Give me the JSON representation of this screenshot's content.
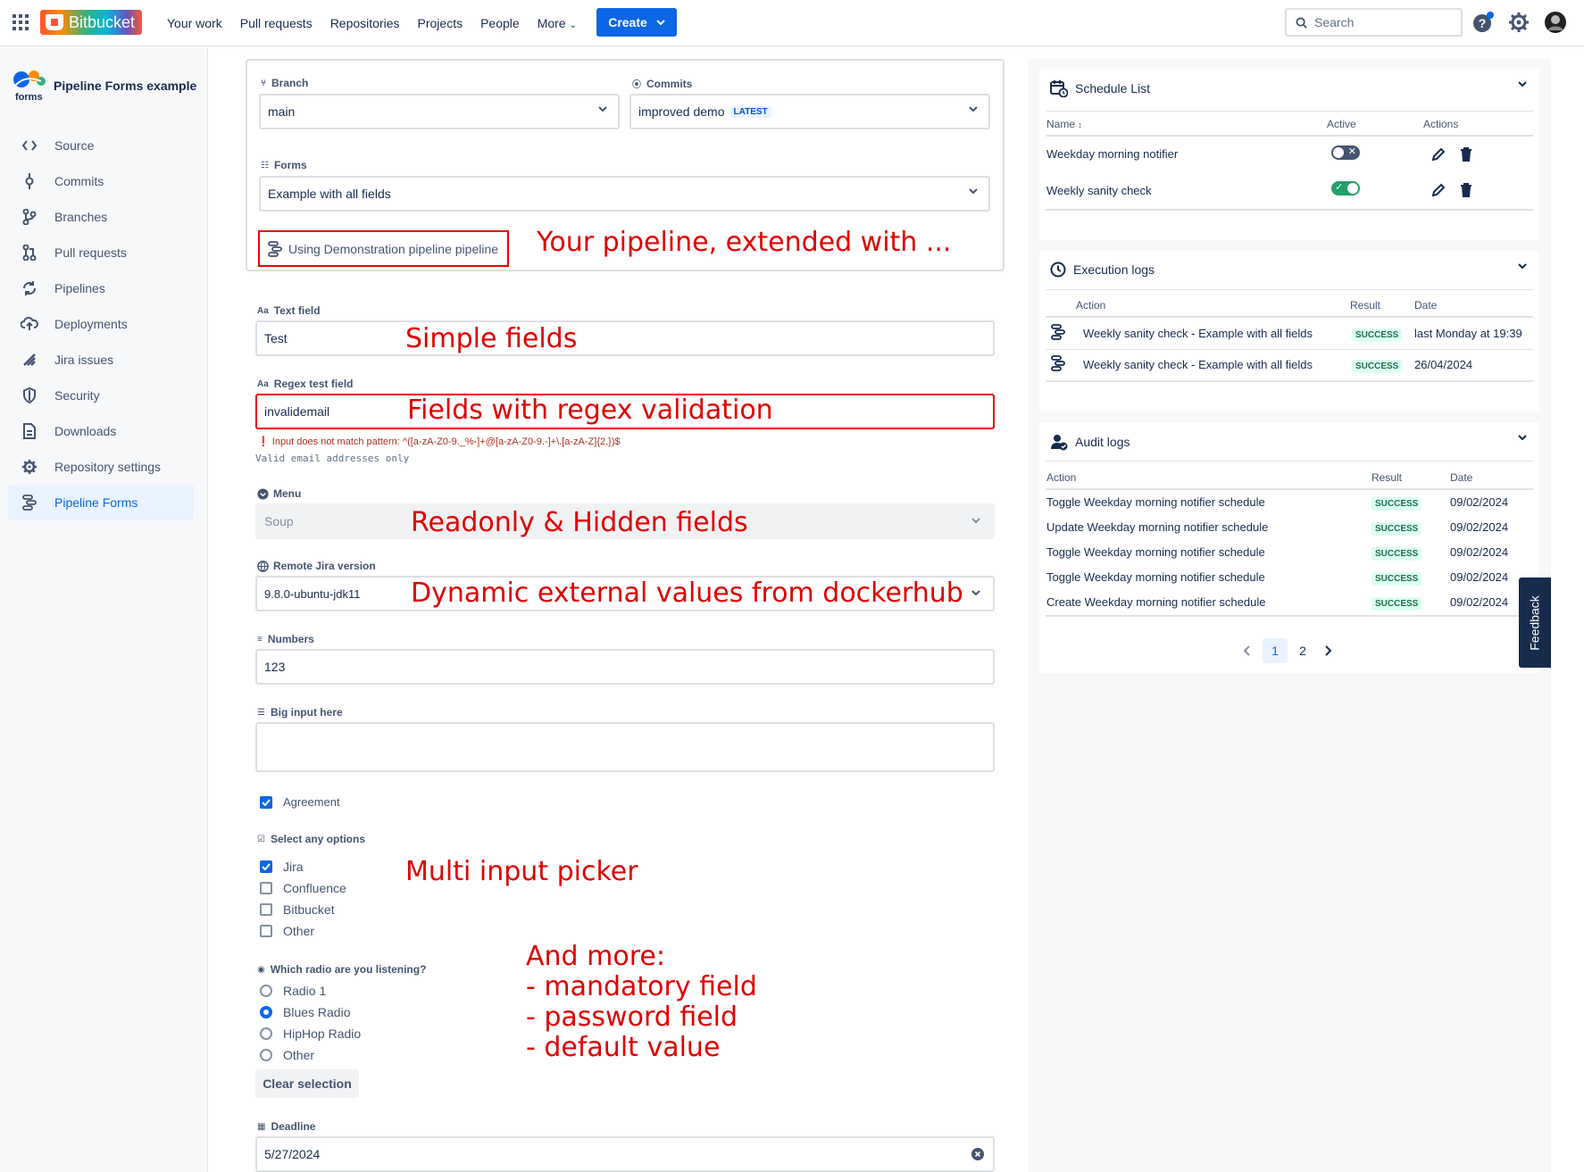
{
  "topnav": {
    "logo_text": "Bitbucket",
    "links": [
      "Your work",
      "Pull requests",
      "Repositories",
      "Projects",
      "People",
      "More"
    ],
    "create_label": "Create",
    "search_placeholder": "Search"
  },
  "sidebar": {
    "project_logo_text": "forms",
    "project_name": "Pipeline Forms example",
    "items": [
      {
        "label": "Source",
        "icon": "code-icon"
      },
      {
        "label": "Commits",
        "icon": "commit-icon"
      },
      {
        "label": "Branches",
        "icon": "branch-icon"
      },
      {
        "label": "Pull requests",
        "icon": "pull-request-icon"
      },
      {
        "label": "Pipelines",
        "icon": "pipelines-icon"
      },
      {
        "label": "Deployments",
        "icon": "cloud-upload-icon"
      },
      {
        "label": "Jira issues",
        "icon": "jira-icon"
      },
      {
        "label": "Security",
        "icon": "shield-icon"
      },
      {
        "label": "Downloads",
        "icon": "document-icon"
      },
      {
        "label": "Repository settings",
        "icon": "gear-icon"
      },
      {
        "label": "Pipeline Forms",
        "icon": "pipeline-forms-icon",
        "active": true
      }
    ]
  },
  "form": {
    "branch_label": "Branch",
    "branch_value": "main",
    "commits_label": "Commits",
    "commit_value": "improved demo",
    "commit_badge": "LATEST",
    "forms_label": "Forms",
    "forms_value": "Example with all fields",
    "pipeline_text": "Using Demonstration pipeline pipeline",
    "text_field_label": "Text field",
    "text_field_value": "Test",
    "regex_label": "Regex test field",
    "regex_value": "invalidemail",
    "regex_error": "Input does not match pattern: ^([a-zA-Z0-9._%-]+@[a-zA-Z0-9.-]+\\.[a-zA-Z]{2,})$",
    "regex_help": "Valid email addresses only",
    "menu_label": "Menu",
    "menu_value": "Soup",
    "jira_version_label": "Remote Jira version",
    "jira_version_value": "9.8.0-ubuntu-jdk11",
    "numbers_label": "Numbers",
    "numbers_value": "123",
    "big_input_label": "Big input here",
    "big_input_value": "",
    "agreement_label": "Agreement",
    "agreement_checked": true,
    "options_label": "Select any options",
    "options": [
      {
        "label": "Jira",
        "checked": true
      },
      {
        "label": "Confluence",
        "checked": false
      },
      {
        "label": "Bitbucket",
        "checked": false
      },
      {
        "label": "Other",
        "checked": false
      }
    ],
    "radio_label": "Which radio are you listening?",
    "radios": [
      {
        "label": "Radio 1",
        "selected": false
      },
      {
        "label": "Blues Radio",
        "selected": true
      },
      {
        "label": "HipHop Radio",
        "selected": false
      },
      {
        "label": "Other",
        "selected": false
      }
    ],
    "clear_selection_label": "Clear selection",
    "deadline_label": "Deadline",
    "deadline_value": "5/27/2024"
  },
  "annotations": {
    "pipeline": "Your pipeline, extended with ...",
    "simple": "Simple fields",
    "regex": "Fields with regex validation",
    "readonly": "Readonly & Hidden fields",
    "dynamic": "Dynamic external values from dockerhub",
    "multi": "Multi input picker",
    "more_lines": [
      "And more:",
      "- mandatory field",
      "- password field",
      "- default value"
    ]
  },
  "schedule": {
    "title": "Schedule List",
    "headers": [
      "Name",
      "Active",
      "Actions"
    ],
    "rows": [
      {
        "name": "Weekday morning notifier",
        "active": false
      },
      {
        "name": "Weekly sanity check",
        "active": true
      }
    ]
  },
  "execution": {
    "title": "Execution logs",
    "headers": [
      "Action",
      "Result",
      "Date"
    ],
    "rows": [
      {
        "action": "Weekly sanity check - Example with all fields",
        "result": "SUCCESS",
        "date": "last Monday at 19:39"
      },
      {
        "action": "Weekly sanity check - Example with all fields",
        "result": "SUCCESS",
        "date": "26/04/2024"
      }
    ]
  },
  "audit": {
    "title": "Audit logs",
    "headers": [
      "Action",
      "Result",
      "Date"
    ],
    "rows": [
      {
        "action": "Toggle Weekday morning notifier schedule",
        "result": "SUCCESS",
        "date": "09/02/2024"
      },
      {
        "action": "Update Weekday morning notifier schedule",
        "result": "SUCCESS",
        "date": "09/02/2024"
      },
      {
        "action": "Toggle Weekday morning notifier schedule",
        "result": "SUCCESS",
        "date": "09/02/2024"
      },
      {
        "action": "Toggle Weekday morning notifier schedule",
        "result": "SUCCESS",
        "date": "09/02/2024"
      },
      {
        "action": "Create Weekday morning notifier schedule",
        "result": "SUCCESS",
        "date": "09/02/2024"
      }
    ],
    "pages": [
      "1",
      "2"
    ],
    "current_page": "1"
  },
  "feedback_label": "Feedback",
  "colors": {
    "brand": "#0c66e4",
    "annotation_red": "#e00000",
    "success_green": "#216e4e"
  }
}
